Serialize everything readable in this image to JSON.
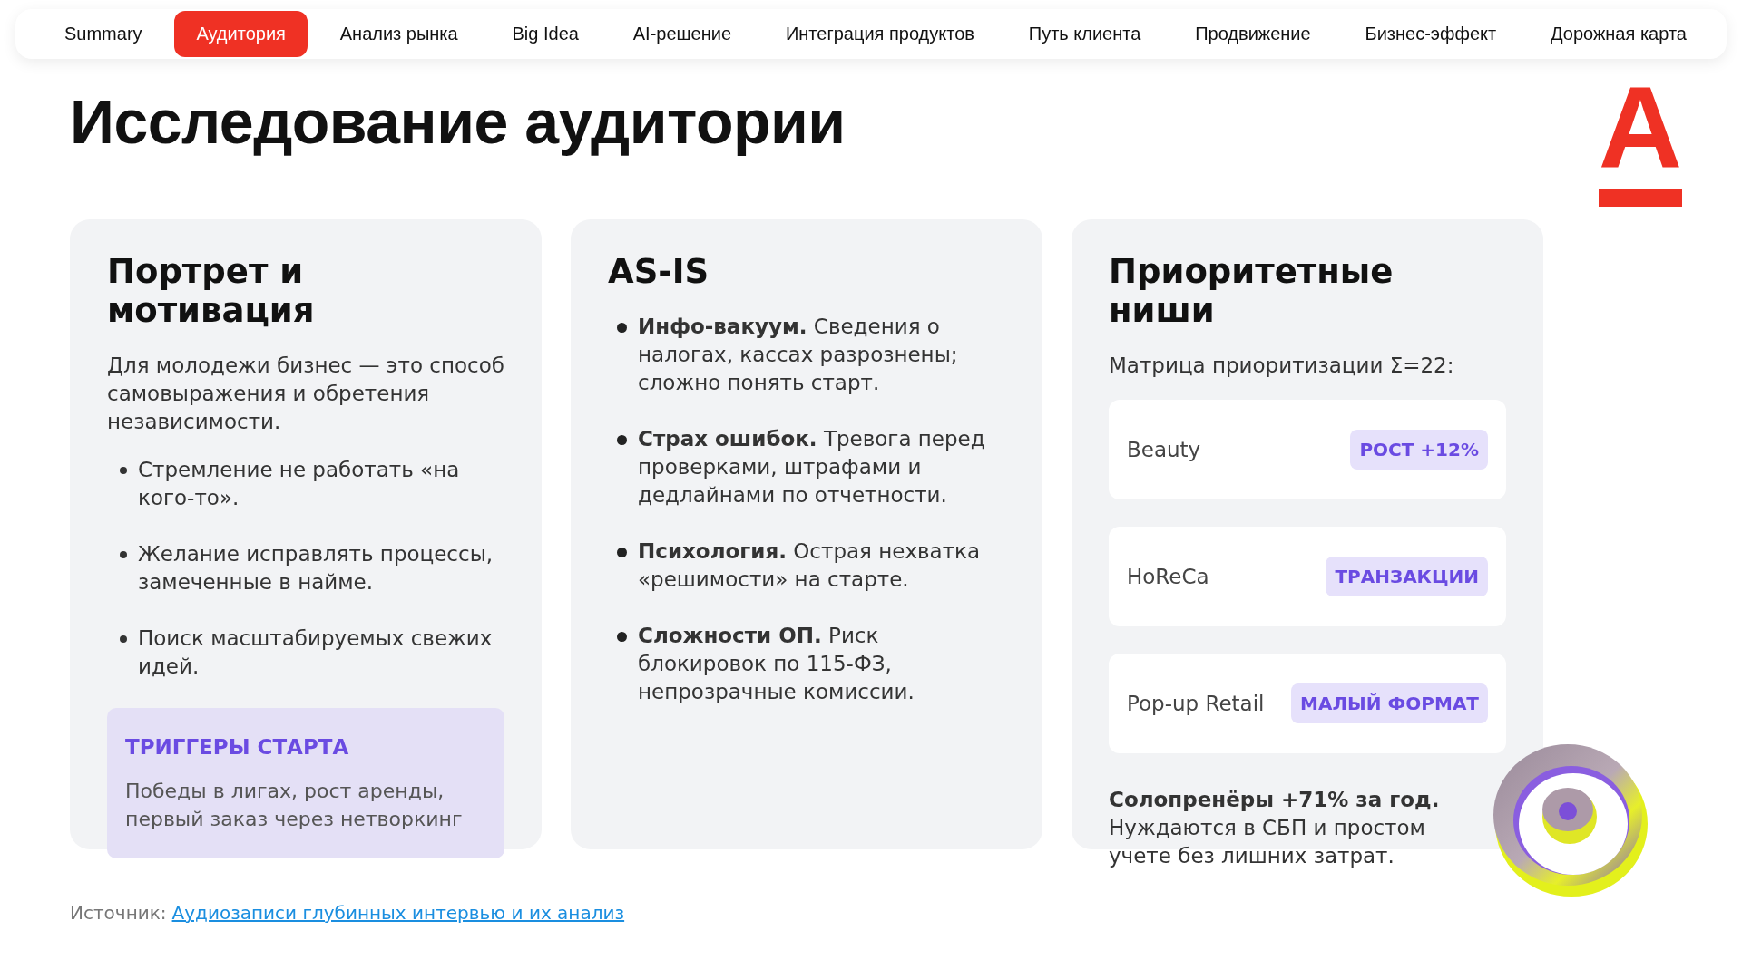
{
  "nav": [
    {
      "label": "Summary",
      "selected": false
    },
    {
      "label": "Аудитория",
      "selected": true
    },
    {
      "label": "Анализ рынка",
      "selected": false
    },
    {
      "label": "Big Idea",
      "selected": false
    },
    {
      "label": "AI-решение",
      "selected": false
    },
    {
      "label": "Интеграция продуктов",
      "selected": false
    },
    {
      "label": "Путь клиента",
      "selected": false
    },
    {
      "label": "Продвижение",
      "selected": false
    },
    {
      "label": "Бизнес-эффект",
      "selected": false
    },
    {
      "label": "Дорожная карта",
      "selected": false
    }
  ],
  "title": "Исследование аудитории",
  "logo_letter": "А",
  "cards": [
    {
      "kind": "portrait",
      "title": "Портрет и мотивация",
      "intro": "Для молодежи бизнес — это способ самовыражения и обретения независимости.",
      "bullets": [
        "Стремление не работать «на кого-то».",
        "Желание исправлять процессы, замеченные в найме.",
        "Поиск масштабируемых свежих идей."
      ],
      "callout": {
        "title": "ТРИГГЕРЫ СТАРТА",
        "text": "Победы в лигах, рост аренды, первый заказ через нетворкинг"
      }
    },
    {
      "kind": "asis",
      "title": "AS-IS",
      "bullets": [
        "**Инфо-вакуум.** Сведения о налогах, кассах разрознены; сложно понять старт.",
        "**Страх ошибок.** Тревога перед проверками, штрафами и дедлайнами по отчетности.",
        "**Психология.** Острая нехватка «решимости» на старте.",
        "**Сложности ОП.** Риск блокировок по 115-ФЗ, непрозрачные комиссии."
      ]
    },
    {
      "kind": "niches",
      "title": "Приоритетные ниши",
      "intro": "Матрица приоритизации Σ=22:",
      "niches": [
        {
          "name": "Beauty",
          "tag": "РОСТ +12%"
        },
        {
          "name": "HoReCa",
          "tag": "ТРАНЗАКЦИИ"
        },
        {
          "name": "Pop-up Retail",
          "tag": "МАЛЫЙ ФОРМАТ"
        }
      ],
      "note": "**Солопренёры +71% за год.** Нуждаются в СБП и простом учете без лишних затрат."
    }
  ],
  "source": {
    "label": "Источник:",
    "link": "Аудиозаписи глубинных интервью и их анализ"
  }
}
